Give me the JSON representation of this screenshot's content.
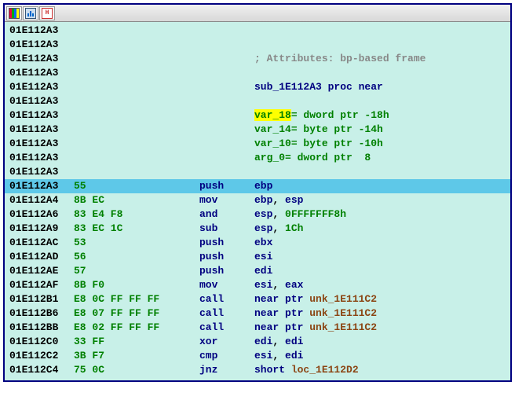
{
  "comment": "; Attributes: bp-based frame",
  "proc_decl": {
    "name": "sub_1E112A3",
    "suffix": " proc near"
  },
  "vars": [
    {
      "name": "var_18",
      "rest": "= dword ptr -18h",
      "hl": true
    },
    {
      "name": "var_14",
      "rest": "= byte ptr -14h",
      "hl": false
    },
    {
      "name": "var_10",
      "rest": "= byte ptr -10h",
      "hl": false
    },
    {
      "name": "arg_0",
      "rest": "= dword ptr  8",
      "hl": false
    }
  ],
  "header_addr": "01E112A3",
  "lines": [
    {
      "addr": "01E112A3",
      "bytes": "55",
      "mnem": "push",
      "ops": [
        {
          "t": "reg",
          "v": "ebp"
        }
      ],
      "sel": true
    },
    {
      "addr": "01E112A4",
      "bytes": "8B EC",
      "mnem": "mov",
      "ops": [
        {
          "t": "reg",
          "v": "ebp"
        },
        {
          "t": "txt",
          "v": ", "
        },
        {
          "t": "reg",
          "v": "esp"
        }
      ]
    },
    {
      "addr": "01E112A6",
      "bytes": "83 E4 F8",
      "mnem": "and",
      "ops": [
        {
          "t": "reg",
          "v": "esp"
        },
        {
          "t": "txt",
          "v": ", "
        },
        {
          "t": "num",
          "v": "0FFFFFFF8h"
        }
      ]
    },
    {
      "addr": "01E112A9",
      "bytes": "83 EC 1C",
      "mnem": "sub",
      "ops": [
        {
          "t": "reg",
          "v": "esp"
        },
        {
          "t": "txt",
          "v": ", "
        },
        {
          "t": "num",
          "v": "1Ch"
        }
      ]
    },
    {
      "addr": "01E112AC",
      "bytes": "53",
      "mnem": "push",
      "ops": [
        {
          "t": "reg",
          "v": "ebx"
        }
      ]
    },
    {
      "addr": "01E112AD",
      "bytes": "56",
      "mnem": "push",
      "ops": [
        {
          "t": "reg",
          "v": "esi"
        }
      ]
    },
    {
      "addr": "01E112AE",
      "bytes": "57",
      "mnem": "push",
      "ops": [
        {
          "t": "reg",
          "v": "edi"
        }
      ]
    },
    {
      "addr": "01E112AF",
      "bytes": "8B F0",
      "mnem": "mov",
      "ops": [
        {
          "t": "reg",
          "v": "esi"
        },
        {
          "t": "txt",
          "v": ", "
        },
        {
          "t": "reg",
          "v": "eax"
        }
      ]
    },
    {
      "addr": "01E112B1",
      "bytes": "E8 0C FF FF FF",
      "mnem": "call",
      "ops": [
        {
          "t": "kw",
          "v": "near ptr "
        },
        {
          "t": "sym",
          "v": "unk_1E111C2"
        }
      ]
    },
    {
      "addr": "01E112B6",
      "bytes": "E8 07 FF FF FF",
      "mnem": "call",
      "ops": [
        {
          "t": "kw",
          "v": "near ptr "
        },
        {
          "t": "sym",
          "v": "unk_1E111C2"
        }
      ]
    },
    {
      "addr": "01E112BB",
      "bytes": "E8 02 FF FF FF",
      "mnem": "call",
      "ops": [
        {
          "t": "kw",
          "v": "near ptr "
        },
        {
          "t": "sym",
          "v": "unk_1E111C2"
        }
      ]
    },
    {
      "addr": "01E112C0",
      "bytes": "33 FF",
      "mnem": "xor",
      "ops": [
        {
          "t": "reg",
          "v": "edi"
        },
        {
          "t": "txt",
          "v": ", "
        },
        {
          "t": "reg",
          "v": "edi"
        }
      ]
    },
    {
      "addr": "01E112C2",
      "bytes": "3B F7",
      "mnem": "cmp",
      "ops": [
        {
          "t": "reg",
          "v": "esi"
        },
        {
          "t": "txt",
          "v": ", "
        },
        {
          "t": "reg",
          "v": "edi"
        }
      ]
    },
    {
      "addr": "01E112C4",
      "bytes": "75 0C",
      "mnem": "jnz",
      "ops": [
        {
          "t": "kw",
          "v": "short "
        },
        {
          "t": "sym",
          "v": "loc_1E112D2"
        }
      ]
    }
  ]
}
